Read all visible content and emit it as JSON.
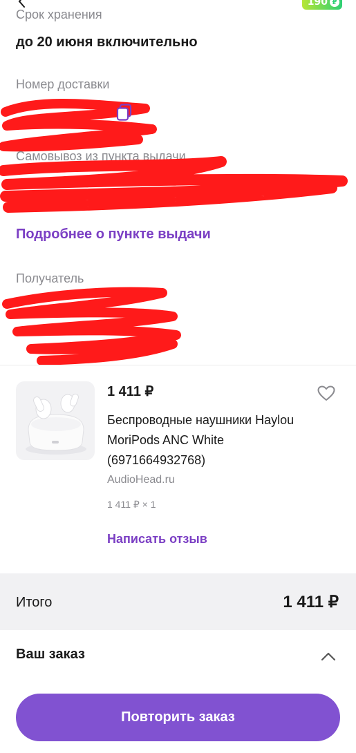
{
  "header": {
    "back_icon": "chevron-left-icon",
    "points": "190",
    "points_icon": "coin-icon"
  },
  "storage": {
    "label": "Срок хранения",
    "value": "до 20 июня включительно"
  },
  "delivery_number": {
    "label": "Номер доставки",
    "copy_icon": "copy-icon"
  },
  "pickup": {
    "label": "Самовывоз из пункта выдачи",
    "details_link": "Подробнее о пункте выдачи"
  },
  "recipient": {
    "label": "Получатель"
  },
  "product": {
    "price": "1 411 ₽",
    "title": "Беспроводные наушники Haylou MoriPods ANC White (6971664932768)",
    "seller": "AudioHead.ru",
    "quantity": "1 411 ₽ × 1",
    "review_link": "Написать отзыв",
    "favorite_icon": "heart-icon"
  },
  "total": {
    "label": "Итого",
    "value": "1 411 ₽"
  },
  "order": {
    "title": "Ваш заказ",
    "toggle_icon": "chevron-up-icon"
  },
  "actions": {
    "repeat_label": "Повторить заказ"
  },
  "colors": {
    "accent": "#7b3fc4",
    "button": "#8152d1",
    "redaction": "#ff1a1a"
  }
}
